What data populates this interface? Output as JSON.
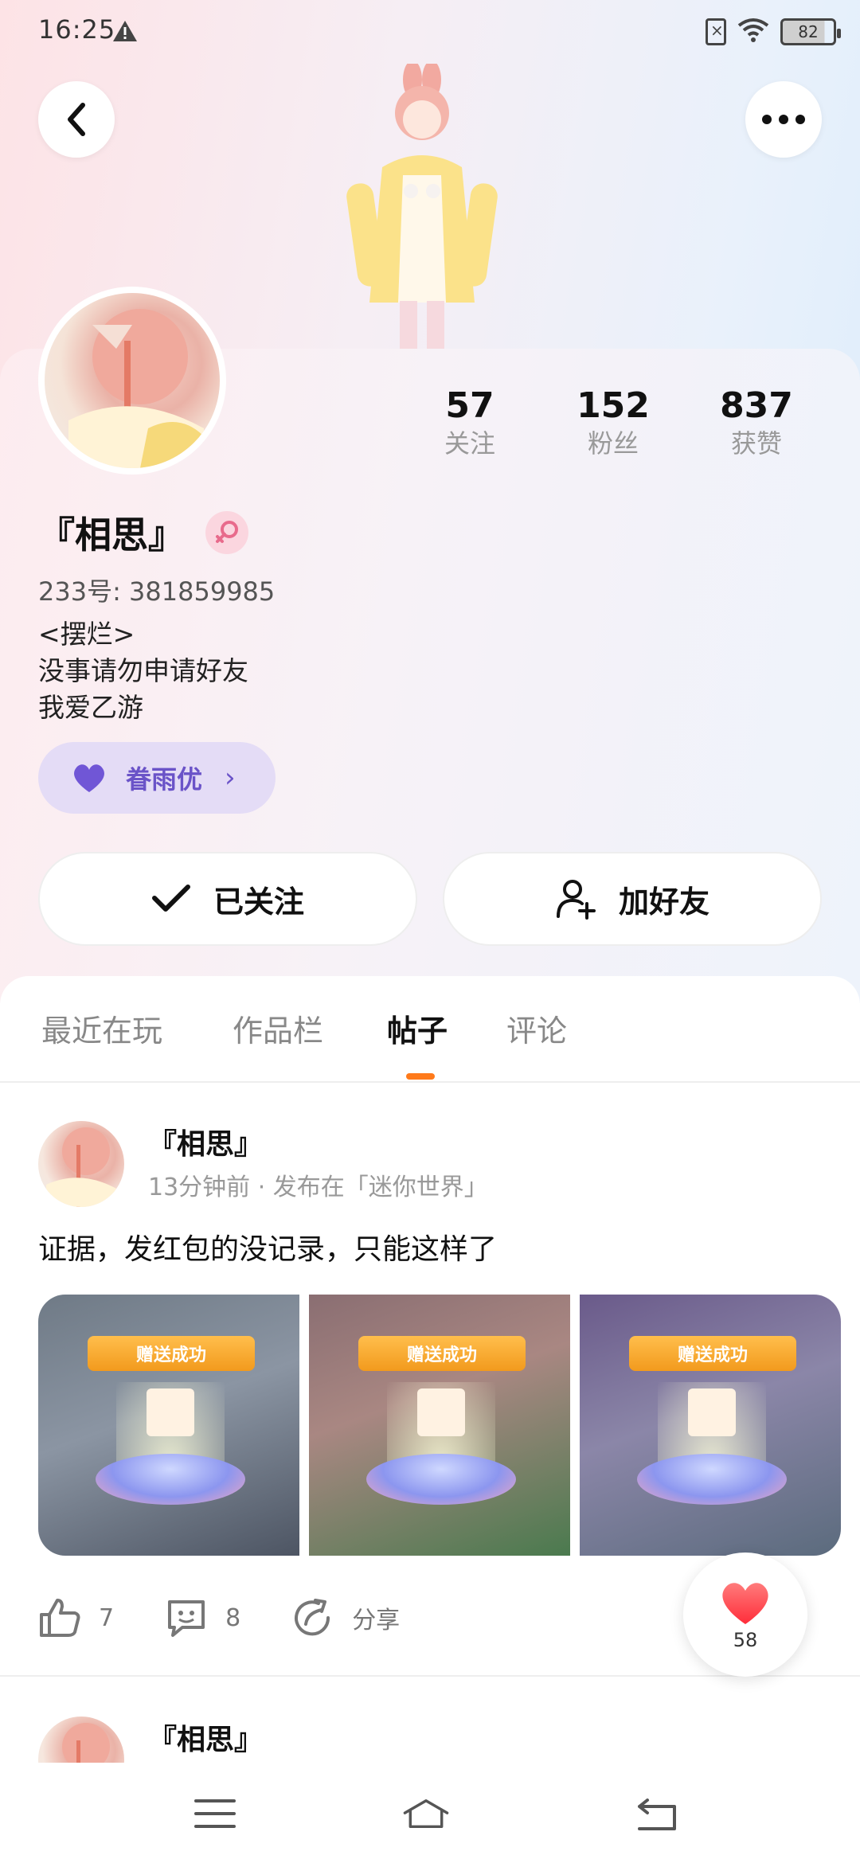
{
  "status_bar": {
    "time": "16:25",
    "battery": "82"
  },
  "profile": {
    "nickname": "『相思』",
    "uid": "233号: 381859985",
    "bio_lines": [
      "<摆烂>",
      "没事请勿申请好友",
      "我爱乙游"
    ],
    "stats": [
      {
        "value": "57",
        "label": "关注"
      },
      {
        "value": "152",
        "label": "粉丝"
      },
      {
        "value": "837",
        "label": "获赞"
      }
    ],
    "vip_label": "眷雨优",
    "follow_label": "已关注",
    "add_friend_label": "加好友"
  },
  "tabs": [
    {
      "label": "最近在玩",
      "active": false
    },
    {
      "label": "作品栏",
      "active": false
    },
    {
      "label": "帖子",
      "active": true
    },
    {
      "label": "评论",
      "active": false
    }
  ],
  "posts": [
    {
      "author": "『相思』",
      "meta": "13分钟前 · 发布在「迷你世界」",
      "text": "证据，发红包的没记录，只能这样了",
      "image_banner": "赠送成功",
      "likes": "7",
      "comments": "8",
      "share_label": "分享"
    },
    {
      "author": "『相思』"
    }
  ],
  "floating_like": {
    "count": "58"
  },
  "colors": {
    "accent": "#ff7a1a",
    "vip": "#6a53c8",
    "like": "#ff3b3b"
  },
  "icons": [
    "back-icon",
    "more-icon",
    "female-icon",
    "heart-icon",
    "check-icon",
    "add-user-icon",
    "thumb-up-icon",
    "comment-icon",
    "share-icon",
    "menu-icon",
    "home-icon",
    "return-icon"
  ]
}
